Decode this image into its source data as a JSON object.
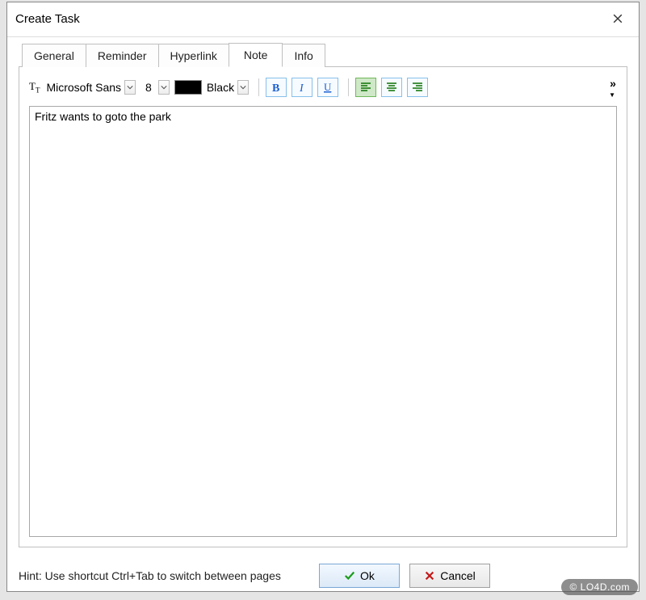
{
  "window": {
    "title": "Create Task"
  },
  "tabs": [
    {
      "label": "General"
    },
    {
      "label": "Reminder"
    },
    {
      "label": "Hyperlink"
    },
    {
      "label": "Note"
    },
    {
      "label": "Info"
    }
  ],
  "active_tab_index": 3,
  "toolbar": {
    "font_name": "Microsoft Sans",
    "font_size": "8",
    "color_swatch": "#000000",
    "color_label": "Black"
  },
  "note_text": "Fritz wants to goto the park",
  "hint": "Hint: Use shortcut Ctrl+Tab to switch between pages",
  "buttons": {
    "ok": "Ok",
    "cancel": "Cancel"
  },
  "watermark": "© LO4D.com"
}
